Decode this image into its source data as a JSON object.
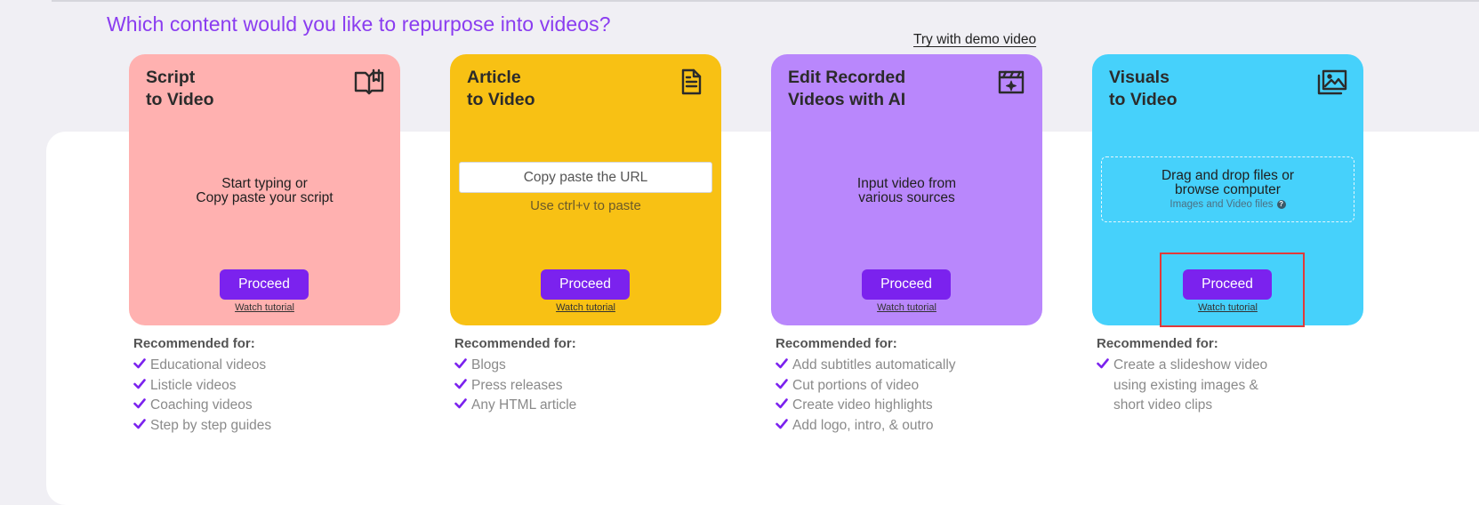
{
  "page": {
    "heading": "Which content would you like to repurpose into videos?",
    "demo_link": "Try with demo video"
  },
  "cards": [
    {
      "title": "Script\nto Video",
      "icon": "book-icon",
      "color": "#ffb1b0",
      "body": "Start typing or\nCopy paste your script",
      "proceed_label": "Proceed",
      "tutorial_label": "Watch tutorial",
      "recommended_title": "Recommended for:",
      "recommended": [
        "Educational videos",
        "Listicle videos",
        "Coaching videos",
        "Step by step guides"
      ]
    },
    {
      "title": "Article\nto Video",
      "icon": "document-icon",
      "color": "#f8c114",
      "url_placeholder": "Copy paste the URL",
      "hint": "Use ctrl+v to paste",
      "proceed_label": "Proceed",
      "tutorial_label": "Watch tutorial",
      "recommended_title": "Recommended for:",
      "recommended": [
        "Blogs",
        "Press releases",
        "Any HTML article"
      ]
    },
    {
      "title": "Edit Recorded\nVideos with AI",
      "icon": "clapperboard-sparkle-icon",
      "color": "#b987fc",
      "body": "Input video from\nvarious sources",
      "proceed_label": "Proceed",
      "tutorial_label": "Watch tutorial",
      "recommended_title": "Recommended for:",
      "recommended": [
        "Add subtitles automatically",
        "Cut portions of video",
        "Create video highlights",
        "Add logo, intro, & outro"
      ]
    },
    {
      "title": "Visuals\nto Video",
      "icon": "image-stack-icon",
      "color": "#46d1fb",
      "dropzone_text": "Drag and drop files or\nbrowse computer",
      "dropzone_sub": "Images and Video files",
      "proceed_label": "Proceed",
      "tutorial_label": "Watch tutorial",
      "recommended_title": "Recommended for:",
      "recommended": [
        "Create a slideshow video\nusing existing images &\nshort video clips"
      ]
    }
  ],
  "colors": {
    "accent": "#7b22ee",
    "heading": "#8a3cf0",
    "highlight": "#e03a3a"
  }
}
